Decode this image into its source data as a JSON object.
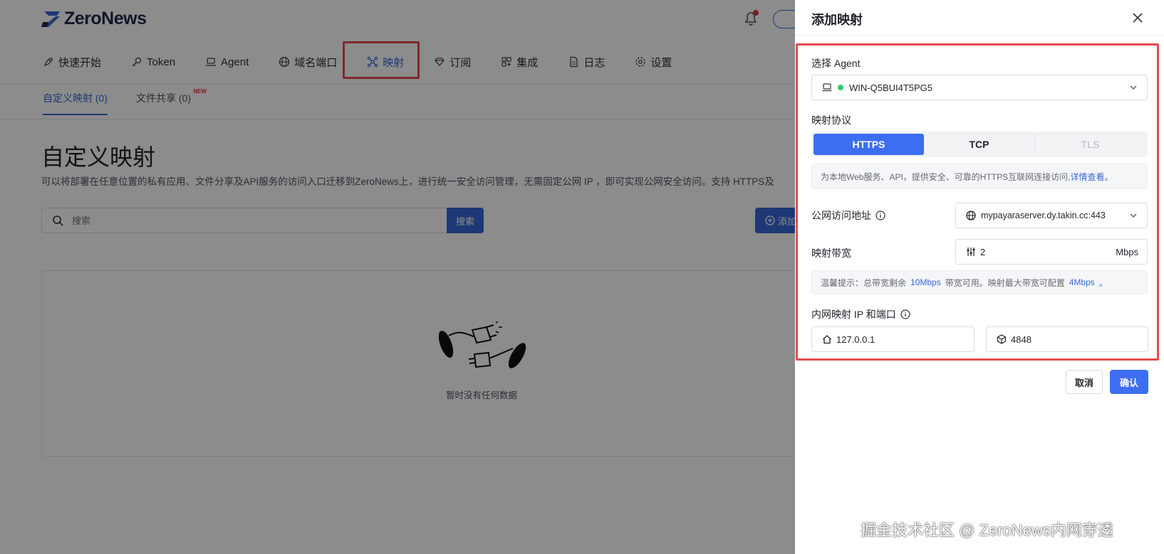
{
  "app": {
    "brand": "ZeroNews",
    "brand_color": "#3867d6",
    "highlight_color": "#e84a4f"
  },
  "nav": {
    "items": [
      {
        "label": "快速开始",
        "icon": "rocket-icon"
      },
      {
        "label": "Token",
        "icon": "key-icon"
      },
      {
        "label": "Agent",
        "icon": "laptop-icon"
      },
      {
        "label": "域名端口",
        "icon": "globe-icon"
      },
      {
        "label": "映射",
        "icon": "network-icon",
        "active": true
      },
      {
        "label": "订阅",
        "icon": "diamond-icon"
      },
      {
        "label": "集成",
        "icon": "apps-icon"
      },
      {
        "label": "日志",
        "icon": "file-icon"
      },
      {
        "label": "设置",
        "icon": "gear-icon"
      }
    ]
  },
  "subtabs": {
    "custom": "自定义映射 (0)",
    "file_share": "文件共享 (0)",
    "new_badge": "NEW"
  },
  "main": {
    "title": "自定义映射",
    "description": "可以将部署在任意位置的私有应用、文件分享及API服务的访问入口迁移到ZeroNews上，进行统一安全访问管理，无需固定公网 IP ，即可实现公网安全访问。支持 HTTPS及",
    "search_placeholder": "搜索",
    "search_button": "搜索",
    "add_button": "添加",
    "empty_text": "暂时没有任何数据"
  },
  "drawer": {
    "title": "添加映射",
    "agent_label": "选择 Agent",
    "agent_value": "WIN-Q5BUI4T5PG5",
    "agent_status_color": "#2ecc71",
    "protocol_label": "映射协议",
    "protocols": [
      "HTTPS",
      "TCP",
      "TLS"
    ],
    "protocol_selected": "HTTPS",
    "protocol_hint": "为本地Web服务、API，提供安全、可靠的HTTPS互联网连接访问,",
    "protocol_hint_link": "详情查看。",
    "public_addr_label": "公网访问地址",
    "public_addr_value": "mypayaraserver.dy.takin.cc:443",
    "bandwidth_label": "映射带宽",
    "bandwidth_value": "2",
    "bandwidth_unit": "Mbps",
    "bandwidth_hint_prefix": "温馨提示：总带宽剩余",
    "bandwidth_total": "10Mbps",
    "bandwidth_hint_mid": "带宽可用。映射最大带宽可配置",
    "bandwidth_max": "4Mbps",
    "bandwidth_hint_suffix": "。",
    "inner_label": "内网映射 IP 和端口",
    "inner_ip": "127.0.0.1",
    "inner_port": "4848",
    "cancel": "取消",
    "confirm": "确认"
  },
  "watermark": "掘金技术社区 @ ZeroNews内网穿透"
}
